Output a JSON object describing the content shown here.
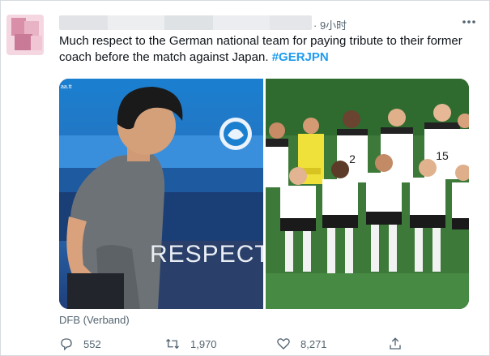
{
  "tweet": {
    "time": "· 9小时",
    "text": "Much respect to the German national team for paying tribute to their former coach before the match against Japan.",
    "hashtag": "#GERJPN",
    "source": "DFB (Verband)",
    "media": {
      "left_watermark": "aa.tt",
      "left_banner": "RESPECT",
      "jersey_numbers": [
        "2",
        "15"
      ]
    }
  },
  "actions": {
    "reply": {
      "icon": "reply-icon",
      "count": "552"
    },
    "retweet": {
      "icon": "retweet-icon",
      "count": "1,970"
    },
    "like": {
      "icon": "like-icon",
      "count": "8,271"
    },
    "share": {
      "icon": "share-icon"
    }
  },
  "colors": {
    "accent": "#1d9bf0",
    "secondary_text": "#536471",
    "primary_text": "#0f1419",
    "border": "#d6dbe0"
  }
}
